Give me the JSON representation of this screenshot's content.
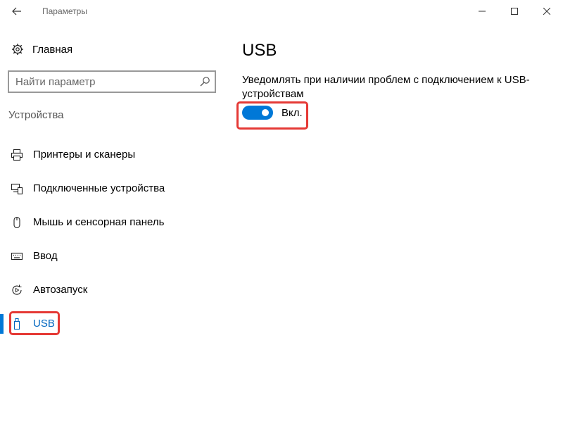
{
  "window": {
    "title": "Параметры",
    "controls": [
      "minimize",
      "maximize",
      "close"
    ]
  },
  "sidebar": {
    "home_label": "Главная",
    "search_placeholder": "Найти параметр",
    "section_header": "Устройства",
    "items": [
      {
        "label": "Принтеры и сканеры",
        "icon": "printer-icon"
      },
      {
        "label": "Подключенные устройства",
        "icon": "devices-icon"
      },
      {
        "label": "Мышь и сенсорная панель",
        "icon": "mouse-icon"
      },
      {
        "label": "Ввод",
        "icon": "keyboard-icon"
      },
      {
        "label": "Автозапуск",
        "icon": "autoplay-icon"
      },
      {
        "label": "USB",
        "icon": "usb-icon",
        "selected": true
      }
    ]
  },
  "content": {
    "title": "USB",
    "description": "Уведомлять при наличии проблем с подключением к USB-устройствам",
    "toggle": {
      "state": "on",
      "label": "Вкл."
    }
  },
  "colors": {
    "accent": "#0078d7",
    "highlight": "#e53935",
    "selected_text": "#0067c0"
  }
}
